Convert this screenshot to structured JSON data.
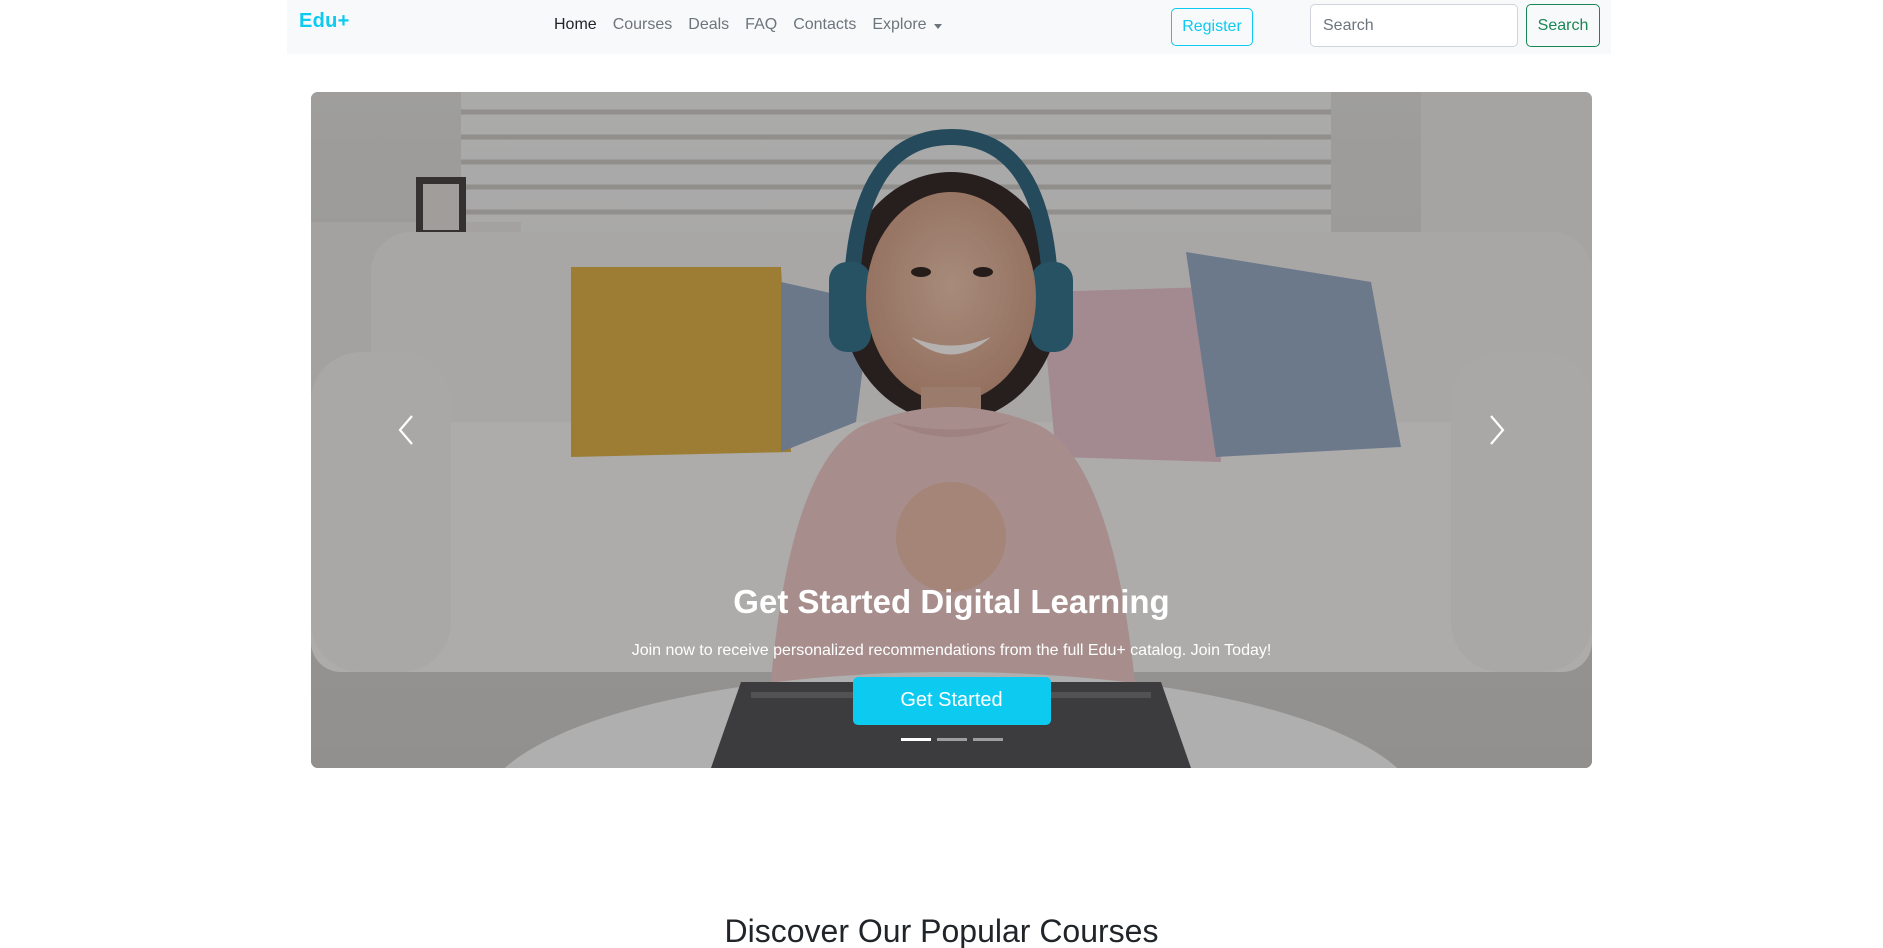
{
  "navbar": {
    "brand": "Edu+",
    "links": [
      {
        "label": "Home",
        "active": true
      },
      {
        "label": "Courses",
        "active": false
      },
      {
        "label": "Deals",
        "active": false
      },
      {
        "label": "FAQ",
        "active": false
      },
      {
        "label": "Contacts",
        "active": false
      }
    ],
    "dropdown_label": "Explore",
    "register_label": "Register",
    "search_placeholder": "Search",
    "search_button_label": "Search"
  },
  "carousel": {
    "image_icon": "woman-with-headphones-photo",
    "title": "Get Started Digital Learning",
    "description": "Join now to receive personalized recommendations from the full Edu+ catalog. Join Today!",
    "cta_label": "Get Started",
    "slide_count": 3,
    "active_slide": 1,
    "prev_icon": "chevron-left-icon",
    "next_icon": "chevron-right-icon"
  },
  "popular": {
    "title": "Discover Our Popular Courses"
  },
  "colors": {
    "brand": "#0dcaf0",
    "success": "#198754",
    "navbar_bg": "#f8f9fa"
  }
}
